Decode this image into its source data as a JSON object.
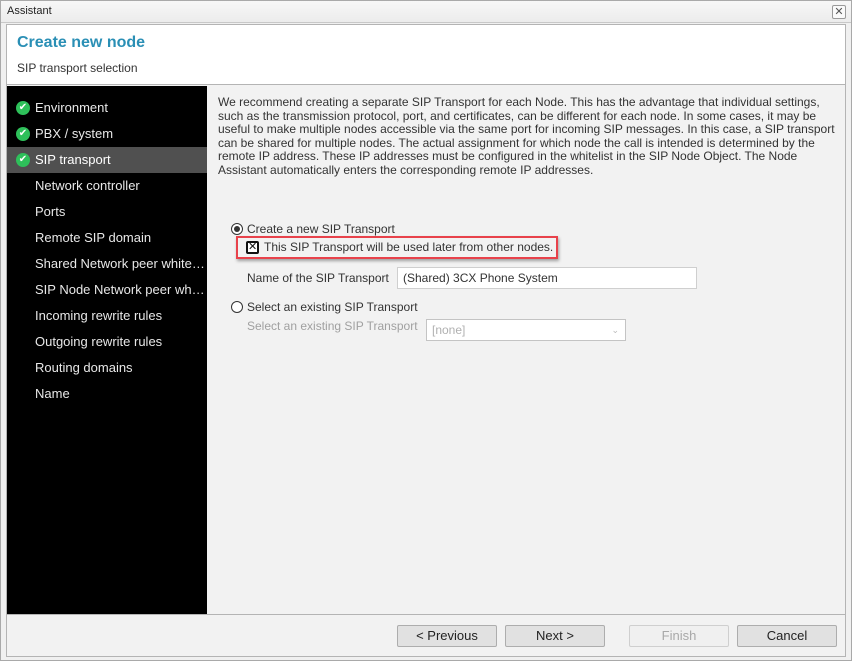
{
  "window": {
    "title": "Assistant",
    "close_icon": "close-icon"
  },
  "header": {
    "title": "Create new node",
    "subtitle": "SIP transport selection"
  },
  "sidebar": {
    "items": [
      {
        "label": "Environment",
        "done": true,
        "active": false
      },
      {
        "label": "PBX / system",
        "done": true,
        "active": false
      },
      {
        "label": "SIP transport",
        "done": true,
        "active": true
      },
      {
        "label": "Network controller",
        "done": false,
        "active": false
      },
      {
        "label": "Ports",
        "done": false,
        "active": false
      },
      {
        "label": "Remote SIP domain",
        "done": false,
        "active": false
      },
      {
        "label": "Shared Network peer whitelist",
        "done": false,
        "active": false
      },
      {
        "label": "SIP Node Network peer whitelist",
        "done": false,
        "active": false
      },
      {
        "label": "Incoming rewrite rules",
        "done": false,
        "active": false
      },
      {
        "label": "Outgoing rewrite rules",
        "done": false,
        "active": false
      },
      {
        "label": "Routing domains",
        "done": false,
        "active": false
      },
      {
        "label": "Name",
        "done": false,
        "active": false
      }
    ],
    "check_icon": "check-circle-icon",
    "check_glyph": "✔"
  },
  "content": {
    "description": "We recommend creating a separate SIP Transport for each Node. This has the advantage that individual settings, such as the transmission protocol, port, and certificates, can be different for each node. In some cases, it may be useful to make multiple nodes accessible via the same port for incoming SIP messages. In this case, a SIP transport can be shared for multiple nodes. The actual assignment for which node the call is intended is determined by the remote IP address. These IP addresses must be configured in the whitelist in the SIP Node Object. The Node Assistant automatically enters the corresponding remote IP addresses.",
    "option_new": {
      "label": "Create a new SIP Transport",
      "selected": true
    },
    "shared_checkbox": {
      "label": "This SIP Transport will be used later from other nodes.",
      "checked": true,
      "glyph": "✕"
    },
    "name_field": {
      "label": "Name of the SIP Transport",
      "value": "(Shared) 3CX Phone System"
    },
    "option_existing": {
      "label": "Select an existing SIP Transport",
      "selected": false
    },
    "existing_select": {
      "label": "Select an existing SIP Transport",
      "value": "[none]",
      "disabled": true,
      "chevron": "⌄"
    }
  },
  "footer": {
    "previous_label": "< Previous",
    "next_label": "Next >",
    "finish_label": "Finish",
    "cancel_label": "Cancel"
  },
  "colors": {
    "accent": "#2a8fb5",
    "highlight": "#e8424b",
    "sidebar_bg": "#000000",
    "sidebar_active": "#505050",
    "check_green": "#2ec05a"
  }
}
